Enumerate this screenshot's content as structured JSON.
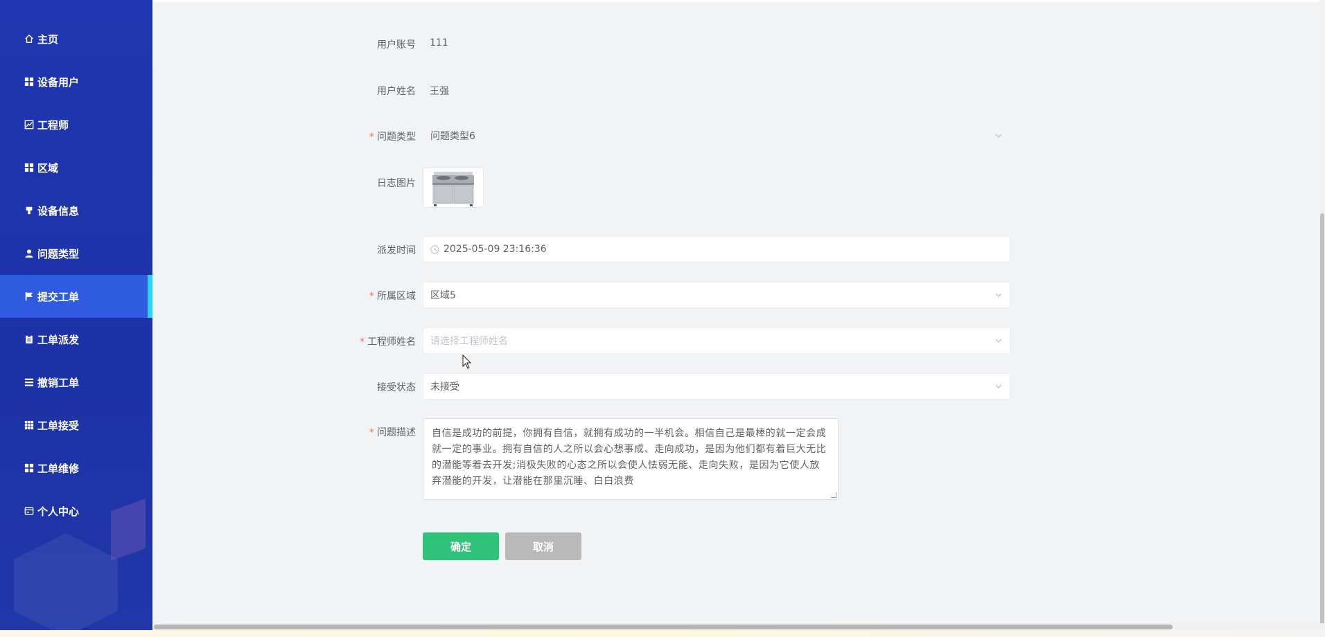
{
  "sidebar": {
    "items": [
      {
        "label": "主页",
        "icon": "home-icon"
      },
      {
        "label": "设备用户",
        "icon": "grid-icon"
      },
      {
        "label": "工程师",
        "icon": "chart-icon"
      },
      {
        "label": "区域",
        "icon": "grid-icon"
      },
      {
        "label": "设备信息",
        "icon": "pin-icon"
      },
      {
        "label": "问题类型",
        "icon": "user-icon"
      },
      {
        "label": "提交工单",
        "icon": "flag-icon",
        "active": true
      },
      {
        "label": "工单派发",
        "icon": "clipboard-icon"
      },
      {
        "label": "撤销工单",
        "icon": "list-icon"
      },
      {
        "label": "工单接受",
        "icon": "table-icon"
      },
      {
        "label": "工单维修",
        "icon": "grid-icon"
      },
      {
        "label": "个人中心",
        "icon": "card-icon"
      }
    ]
  },
  "form": {
    "account": {
      "label": "用户账号",
      "value": "111"
    },
    "username": {
      "label": "用户姓名",
      "value": "王强"
    },
    "problem_type": {
      "label": "问题类型",
      "value": "问题类型6",
      "required": true
    },
    "log_image": {
      "label": "日志图片"
    },
    "dispatch_time": {
      "label": "派发时间",
      "value": "2025-05-09 23:16:36"
    },
    "region": {
      "label": "所属区域",
      "value": "区域5",
      "required": true
    },
    "engineer": {
      "label": "工程师姓名",
      "placeholder": "请选择工程师姓名",
      "required": true
    },
    "accept_status": {
      "label": "接受状态",
      "value": "未接受"
    },
    "description": {
      "label": "问题描述",
      "required": true,
      "value": "自信是成功的前提，你拥有自信，就拥有成功的一半机会。相信自己是最棒的就一定会成就一定的事业。拥有自信的人之所以会心想事成、走向成功，是因为他们都有着巨大无比的潜能等着去开发;消极失败的心态之所以会使人怯弱无能、走向失败，是因为它使人放弃潜能的开发，让潜能在那里沉睡、白白浪费"
    },
    "confirm_label": "确定",
    "cancel_label": "取消"
  },
  "colors": {
    "sidebar_bg": "#1f36b0",
    "active_item_bg": "#2e5be0",
    "active_indicator": "#25d8f5",
    "confirm_button": "#2fc37a",
    "cancel_button": "#b9b9b9",
    "required_star": "#f56c6c"
  }
}
